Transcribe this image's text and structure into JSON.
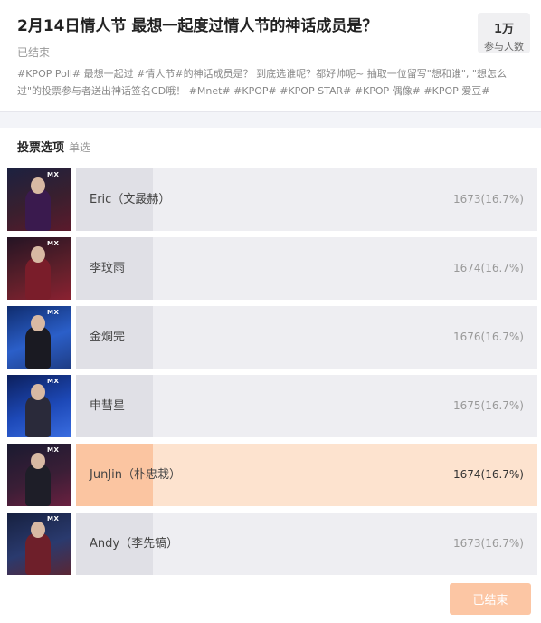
{
  "header": {
    "title": "2月14日情人节 最想一起度过情人节的神话成员是？",
    "status": "已结束",
    "participants_count": "1万",
    "participants_label": "参与人数",
    "description": "#KPOP Poll# 最想一起过 #情人节#的神话成员是？ 到底选谁呢？都好帅呢~ 抽取一位留写\"想和谁\", \"想怎么过\"的投票参与者送出神话签名CD哦！ #Mnet# #KPOP# #KPOP STAR# #KPOP 偶像# #KPOP 爱豆#"
  },
  "poll": {
    "section_title": "投票选项",
    "section_type": "单选",
    "options": [
      {
        "name": "Eric（文晸赫）",
        "stat": "1673(16.7%)",
        "percent": 16.7,
        "selected": false
      },
      {
        "name": "李玟雨",
        "stat": "1674(16.7%)",
        "percent": 16.7,
        "selected": false
      },
      {
        "name": "金烔完",
        "stat": "1676(16.7%)",
        "percent": 16.7,
        "selected": false
      },
      {
        "name": "申彗星",
        "stat": "1675(16.7%)",
        "percent": 16.7,
        "selected": false
      },
      {
        "name": "JunJin（朴忠栽）",
        "stat": "1674(16.7%)",
        "percent": 16.7,
        "selected": true
      },
      {
        "name": "Andy（李先镐）",
        "stat": "1673(16.7%)",
        "percent": 16.7,
        "selected": false
      }
    ],
    "thumb_logo": "MX",
    "end_button_label": "已结束"
  },
  "colors": {
    "selected_bg": "#fde3cf",
    "selected_fill": "#fbc5a1",
    "button_bg": "#fcc6a4"
  }
}
